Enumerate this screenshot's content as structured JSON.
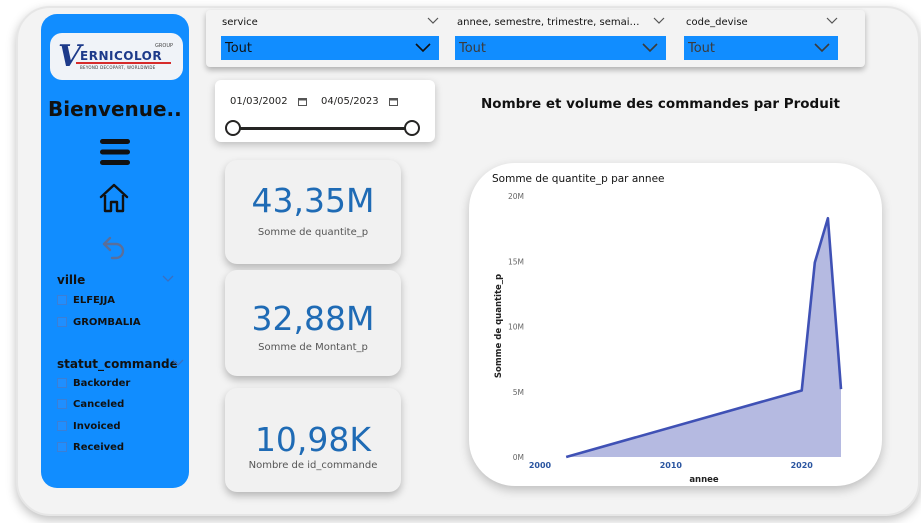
{
  "brand": {
    "logo_letter": "V",
    "logo_name": "ERNICOLOR",
    "logo_group": "GROUP",
    "logo_tagline": "BEYOND DECOPART, WORLDWIDE"
  },
  "sidebar": {
    "welcome": "Bienvenue..",
    "icons": [
      "hamburger-menu-icon",
      "home-icon",
      "back-arrow-icon"
    ],
    "ville": {
      "title": "ville",
      "items": [
        "ELFEJJA",
        "GROMBALIA"
      ]
    },
    "statut": {
      "title": "statut_commande",
      "items": [
        "Backorder",
        "Canceled",
        "Invoiced",
        "Received"
      ]
    }
  },
  "filters": [
    {
      "label": "service",
      "value": "Tout"
    },
    {
      "label": "annee, semestre, trimestre, semai…",
      "value": "Tout"
    },
    {
      "label": "code_devise",
      "value": "Tout"
    }
  ],
  "date_range": {
    "start": "01/03/2002",
    "end": "04/05/2023"
  },
  "kpis": [
    {
      "value": "43,35M",
      "label": "Somme de quantite_p"
    },
    {
      "value": "32,88M",
      "label": "Somme de Montant_p"
    },
    {
      "value": "10,98K",
      "label": "Nombre de id_commande"
    }
  ],
  "colors": {
    "sidebar": "#118dff",
    "kpi_value": "#1f6bb5",
    "series_line": "#3f51b5",
    "series_fill": "#a8aedc"
  },
  "chart_data": {
    "type": "area",
    "title": "Nombre et volume des commandes par Produit",
    "subtitle": "Somme de quantite_p par annee",
    "xlabel": "annee",
    "ylabel": "Somme de quantite_p",
    "x_ticks": [
      2000,
      2010,
      2020
    ],
    "y_ticks": [
      "0M",
      "5M",
      "10M",
      "15M",
      "20M"
    ],
    "y_tick_values": [
      0,
      5000000,
      10000000,
      15000000,
      20000000
    ],
    "xlim": [
      2000,
      2023
    ],
    "ylim": [
      0,
      20000000
    ],
    "grid": false,
    "series": [
      {
        "x": [
          2002,
          2020,
          2021,
          2022,
          2023
        ],
        "values": [
          0,
          5100000,
          14900000,
          18300000,
          5200000
        ]
      }
    ]
  }
}
